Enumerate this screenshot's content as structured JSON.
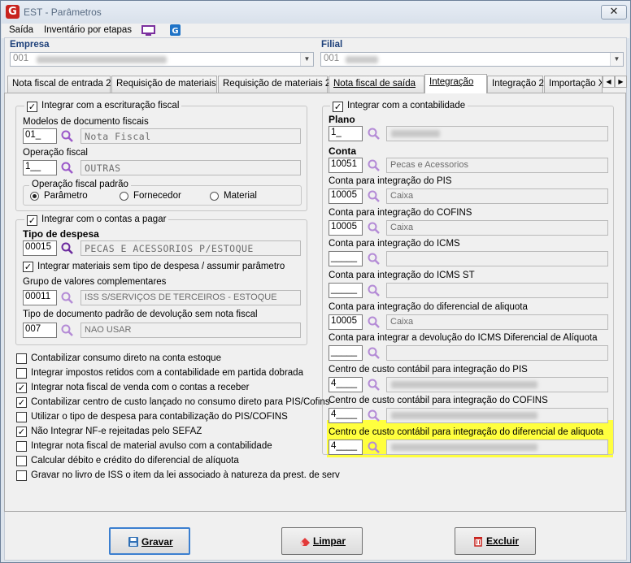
{
  "window": {
    "title": "EST - Parâmetros",
    "close_glyph": "✕"
  },
  "menu": {
    "items": [
      "Saída",
      "Inventário por etapas"
    ]
  },
  "company": {
    "label": "Empresa",
    "value": "001"
  },
  "branch": {
    "label": "Filial",
    "value": "001"
  },
  "tabs": [
    "Nota fiscal de entrada 2",
    "Requisição de materiais",
    "Requisição de materiais 2",
    "Nota fiscal de saída",
    "Integração",
    "Integração 2",
    "Importação X"
  ],
  "active_tab": "Integração",
  "left": {
    "fiscal_group": {
      "title": "Integrar com a escrituração fiscal",
      "checked": true,
      "doc_models_label": "Modelos de documento fiscais",
      "doc_models_code": "01_",
      "doc_models_desc": "Nota Fiscal",
      "fiscal_op_label": "Operação fiscal",
      "fiscal_op_code": "1__",
      "fiscal_op_desc": "OUTRAS",
      "default_op": {
        "title": "Operação fiscal padrão",
        "options": [
          "Parâmetro",
          "Fornecedor",
          "Material"
        ],
        "selected": "Parâmetro"
      }
    },
    "payables_group": {
      "title": "Integrar com o contas a pagar",
      "checked": true,
      "expense_type_label": "Tipo de despesa",
      "expense_type_code": "00015",
      "expense_type_desc": "PECAS E ACESSORIOS P/ESTOQUE",
      "integrate_materials_label": "Integrar materiais sem tipo de despesa / assumir parâmetro",
      "integrate_materials_checked": true,
      "value_group_label": "Grupo de valores complementares",
      "value_group_code": "00011",
      "value_group_desc": "ISS S/SERVIÇOS DE TERCEIROS - ESTOQUE",
      "return_doc_label": "Tipo de documento padrão de devolução sem nota fiscal",
      "return_doc_code": "007",
      "return_doc_desc": "NAO USAR"
    },
    "options": [
      {
        "label": "Contabilizar consumo direto na conta estoque",
        "checked": false
      },
      {
        "label": "Integrar impostos retidos com a contabilidade em partida dobrada",
        "checked": false
      },
      {
        "label": "Integrar nota fiscal de venda com o contas a receber",
        "checked": true
      },
      {
        "label": "Contabilizar centro de custo lançado no consumo direto para PIS/Cofins",
        "checked": true
      },
      {
        "label": "Utilizar o tipo de despesa para contabilização do PIS/COFINS",
        "checked": false
      },
      {
        "label": "Não Integrar NF-e rejeitadas pelo SEFAZ",
        "checked": true
      },
      {
        "label": "Integrar nota fiscal de material avulso com a contabilidade",
        "checked": false
      },
      {
        "label": "Calcular débito e crédito do diferencial de alíquota",
        "checked": false
      },
      {
        "label": "Gravar no livro de ISS o item da lei associado à natureza da prest. de serv",
        "checked": false
      }
    ]
  },
  "right": {
    "title": "Integrar com a contabilidade",
    "checked": true,
    "fields": [
      {
        "label": "Plano",
        "code": "1_",
        "desc": "",
        "bold": true
      },
      {
        "label": "Conta",
        "code": "10051",
        "desc": "Pecas e Acessorios",
        "bold": true
      },
      {
        "label": "Conta para integração do PIS",
        "code": "10005",
        "desc": "Caixa",
        "bold": false
      },
      {
        "label": "Conta para integração do COFINS",
        "code": "10005",
        "desc": "Caixa",
        "bold": false
      },
      {
        "label": "Conta para integração do ICMS",
        "code": "_____",
        "desc": "",
        "bold": false
      },
      {
        "label": "Conta para integração do ICMS ST",
        "code": "_____",
        "desc": "",
        "bold": false
      },
      {
        "label": "Conta para integração do diferencial de aliquota",
        "code": "10005",
        "desc": "Caixa",
        "bold": false
      },
      {
        "label": "Conta para integrar a devolução do ICMS Diferencial de Alíquota",
        "code": "_____",
        "desc": "",
        "bold": false
      },
      {
        "label": "Centro de custo contábil para integração do PIS",
        "code": "4____",
        "desc": "",
        "bold": false
      },
      {
        "label": "Centro de custo contábil para integração do COFINS",
        "code": "4____",
        "desc": "",
        "bold": false
      },
      {
        "label": "Centro de custo contábil para integração do diferencial de aliquota",
        "code": "4____",
        "desc": "",
        "bold": false
      }
    ]
  },
  "buttons": {
    "save": "Gravar",
    "clear": "Limpar",
    "delete": "Excluir"
  },
  "colors": {
    "highlight": "#ffff3e",
    "lens": "#9b59c9",
    "app_logo": "#c8231e"
  }
}
